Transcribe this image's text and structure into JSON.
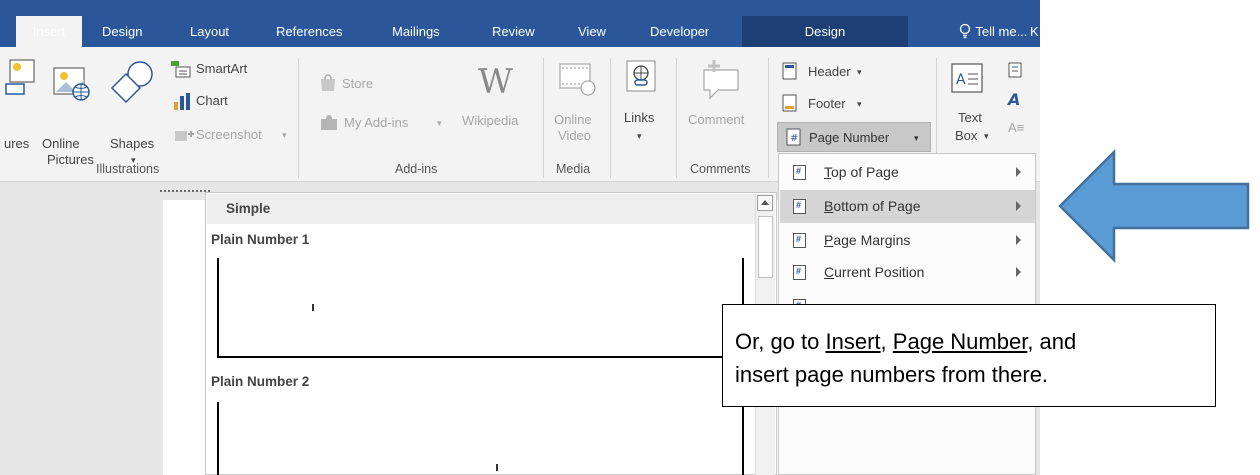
{
  "tabs": [
    "Insert",
    "Design",
    "Layout",
    "References",
    "Mailings",
    "Review",
    "View",
    "Developer"
  ],
  "context_tab": "Design",
  "tell_me": "Tell me...",
  "tell_me_tail": "K",
  "ribbon": {
    "illustrations": {
      "pictures_partial": "ures",
      "online_pictures_1": "Online",
      "online_pictures_2": "Pictures",
      "shapes": "Shapes",
      "smartart": "SmartArt",
      "chart": "Chart",
      "screenshot": "Screenshot",
      "group_label": "Illustrations"
    },
    "addins": {
      "store": "Store",
      "my_addins": "My Add-ins",
      "wikipedia": "Wikipedia",
      "group_label": "Add-ins"
    },
    "media": {
      "online_video_1": "Online",
      "online_video_2": "Video",
      "group_label": "Media"
    },
    "links": {
      "label": "Links"
    },
    "comments": {
      "comment": "Comment",
      "group_label": "Comments"
    },
    "header_footer": {
      "header": "Header",
      "footer": "Footer",
      "page_number": "Page Number"
    },
    "text": {
      "text_box_1": "Text",
      "text_box_2": "Box"
    }
  },
  "page_number_menu": [
    {
      "pre": "",
      "key": "T",
      "post": "op of Page",
      "submenu": true
    },
    {
      "pre": "",
      "key": "B",
      "post": "ottom of Page",
      "submenu": true,
      "highlighted": true
    },
    {
      "pre": "",
      "key": "P",
      "post": "age Margins",
      "submenu": true
    },
    {
      "pre": "",
      "key": "C",
      "post": "urrent Position",
      "submenu": true
    }
  ],
  "gallery": {
    "section": "Simple",
    "item1": "Plain Number 1",
    "item2": "Plain Number 2"
  },
  "callout": {
    "text_or": "Or, go to",
    "link_insert": "Insert",
    "comma1": ",",
    "link_page_number": "Page Number",
    "and": ", and",
    "line2": "insert page numbers from there."
  },
  "colors": {
    "ribbon_blue": "#2b579a",
    "context_tab": "#1e3f75",
    "arrow_fill": "#5b9bd5",
    "arrow_stroke": "#41719c",
    "menu_highlight": "#d5d5d5"
  }
}
